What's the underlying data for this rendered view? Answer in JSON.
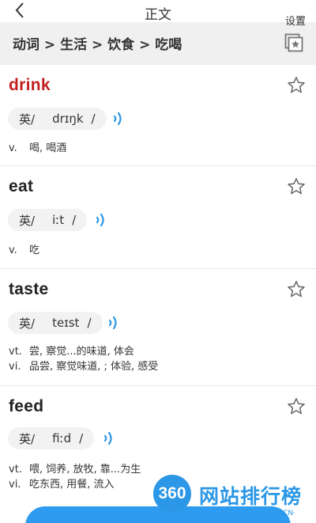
{
  "header": {
    "title": "正文",
    "back_icon": "chevron-left-icon",
    "settings_label": "设置"
  },
  "breadcrumb": "动词 > 生活 > 饮食 > 吃喝",
  "words": [
    {
      "word": "drink",
      "lang": "英/",
      "phonetic": "drɪŋk",
      "slash": "/",
      "defs": [
        {
          "pos": "v.",
          "text": "喝, 喝酒"
        }
      ]
    },
    {
      "word": "eat",
      "lang": "英/",
      "phonetic": "iːt",
      "slash": "/",
      "defs": [
        {
          "pos": "v.",
          "text": "吃"
        }
      ]
    },
    {
      "word": "taste",
      "lang": "英/",
      "phonetic": "teɪst",
      "slash": "/",
      "defs": [
        {
          "pos": "vt.",
          "text": "尝, 察觉...的味道, 体会"
        },
        {
          "pos": "vi.",
          "text": "品尝, 察觉味道, ; 体验, 感受"
        }
      ]
    },
    {
      "word": "feed",
      "lang": "英/",
      "phonetic": "fiːd",
      "slash": "/",
      "defs": [
        {
          "pos": "vt.",
          "text": "喂, 饲养, 放牧, 靠...为生"
        },
        {
          "pos": "vi.",
          "text": "吃东西, 用餐, 流入"
        }
      ]
    }
  ],
  "watermark": {
    "badge": "360",
    "text": "网站排行榜",
    "suffix": "·CN·"
  },
  "colors": {
    "highlight_word": "#c31f1f",
    "accent": "#2b97e6",
    "chip_bg": "#f2f2f2",
    "crumb_bg": "#f0f0f0"
  }
}
